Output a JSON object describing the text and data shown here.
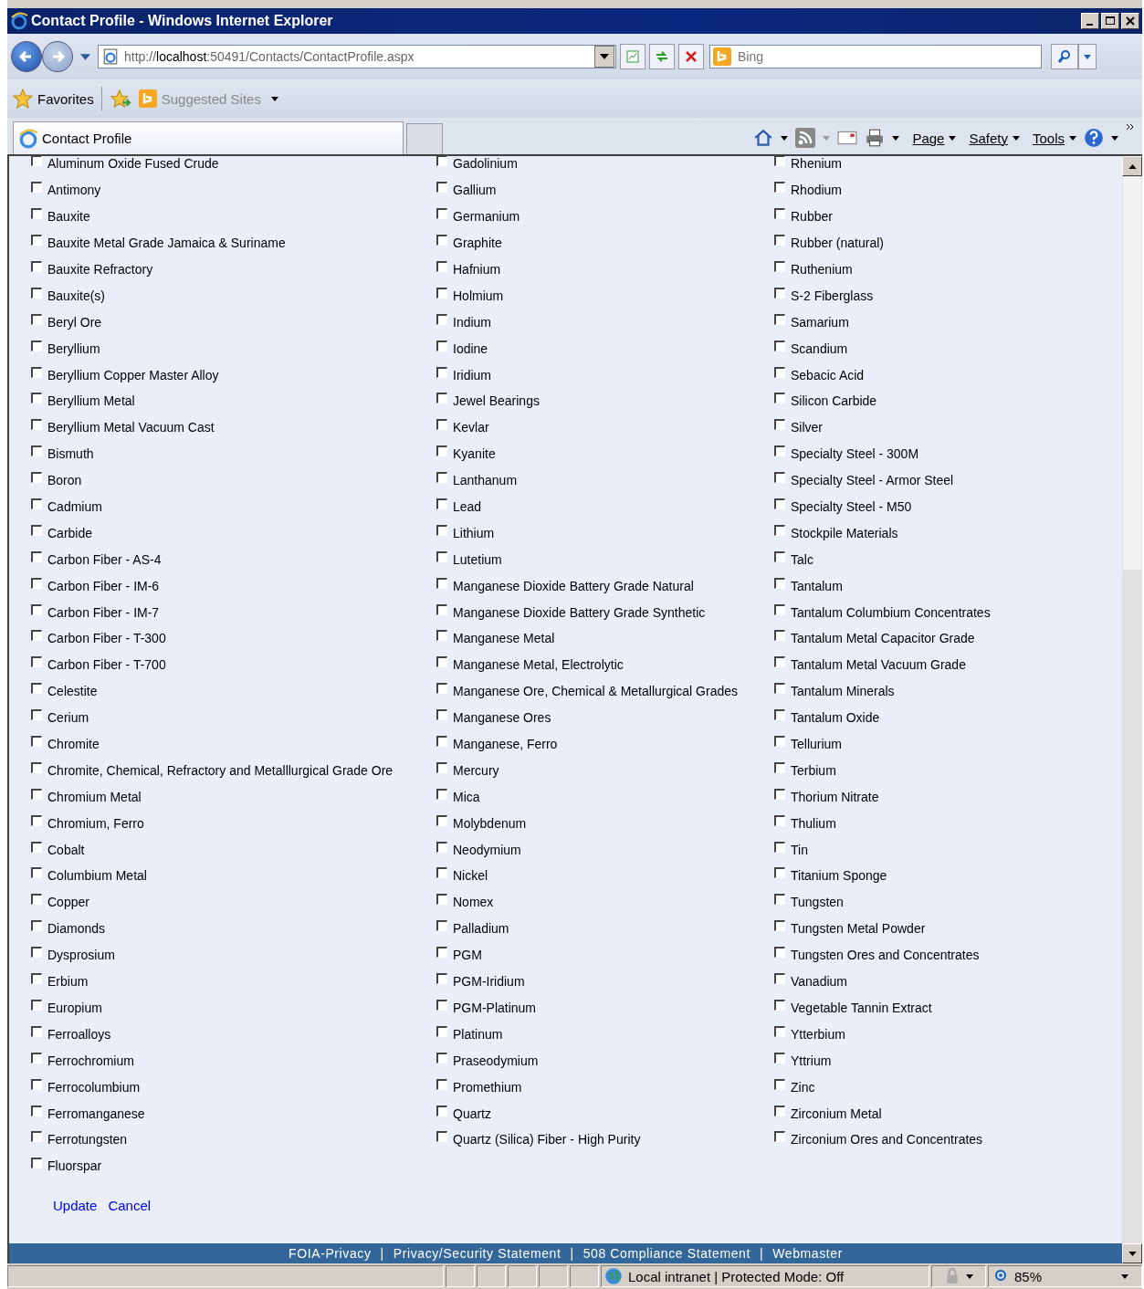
{
  "window": {
    "title": "Contact Profile - Windows Internet Explorer"
  },
  "address_bar": {
    "url_prefix": "http://",
    "url_host": "localhost",
    "url_rest": ":50491/Contacts/ContactProfile.aspx"
  },
  "search": {
    "placeholder": "Bing"
  },
  "favorites_bar": {
    "favorites": "Favorites",
    "suggested_sites": "Suggested Sites"
  },
  "tabs": [
    {
      "label": "Contact Profile",
      "selected": true
    }
  ],
  "command_bar": [
    "Page",
    "Safety",
    "Tools"
  ],
  "columns": [
    {
      "items": [
        {
          "label": "Aluminum Oxide Fused Crude",
          "checked": false
        },
        {
          "label": "Antimony",
          "checked": false
        },
        {
          "label": "Bauxite",
          "checked": false
        },
        {
          "label": "Bauxite Metal Grade Jamaica & Suriname",
          "checked": false
        },
        {
          "label": "Bauxite Refractory",
          "checked": false
        },
        {
          "label": "Bauxite(s)",
          "checked": false
        },
        {
          "label": "Beryl Ore",
          "checked": false
        },
        {
          "label": "Beryllium",
          "checked": false
        },
        {
          "label": "Beryllium Copper Master Alloy",
          "checked": false
        },
        {
          "label": "Beryllium Metal",
          "checked": false
        },
        {
          "label": "Beryllium Metal Vacuum Cast",
          "checked": false
        },
        {
          "label": "Bismuth",
          "checked": false
        },
        {
          "label": "Boron",
          "checked": false
        },
        {
          "label": "Cadmium",
          "checked": false
        },
        {
          "label": "Carbide",
          "checked": false
        },
        {
          "label": "Carbon Fiber - AS-4",
          "checked": false
        },
        {
          "label": "Carbon Fiber - IM-6",
          "checked": false
        },
        {
          "label": "Carbon Fiber - IM-7",
          "checked": false
        },
        {
          "label": "Carbon Fiber - T-300",
          "checked": false
        },
        {
          "label": "Carbon Fiber - T-700",
          "checked": false
        },
        {
          "label": "Celestite",
          "checked": false
        },
        {
          "label": "Cerium",
          "checked": false
        },
        {
          "label": "Chromite",
          "checked": false
        },
        {
          "label": "Chromite, Chemical, Refractory and Metalllurgical Grade Ore",
          "checked": false
        },
        {
          "label": "Chromium Metal",
          "checked": false
        },
        {
          "label": "Chromium, Ferro",
          "checked": false
        },
        {
          "label": "Cobalt",
          "checked": false
        },
        {
          "label": "Columbium Metal",
          "checked": false
        },
        {
          "label": "Copper",
          "checked": false
        },
        {
          "label": "Diamonds",
          "checked": false
        },
        {
          "label": "Dysprosium",
          "checked": false
        },
        {
          "label": "Erbium",
          "checked": false
        },
        {
          "label": "Europium",
          "checked": false
        },
        {
          "label": "Ferroalloys",
          "checked": false
        },
        {
          "label": "Ferrochromium",
          "checked": false
        },
        {
          "label": "Ferrocolumbium",
          "checked": false
        },
        {
          "label": "Ferromanganese",
          "checked": false
        },
        {
          "label": "Ferrotungsten",
          "checked": false
        },
        {
          "label": "Fluorspar",
          "checked": false
        }
      ]
    },
    {
      "items": [
        {
          "label": "Gadolinium",
          "checked": false
        },
        {
          "label": "Gallium",
          "checked": false
        },
        {
          "label": "Germanium",
          "checked": false
        },
        {
          "label": "Graphite",
          "checked": false
        },
        {
          "label": "Hafnium",
          "checked": false
        },
        {
          "label": "Holmium",
          "checked": false
        },
        {
          "label": "Indium",
          "checked": false
        },
        {
          "label": "Iodine",
          "checked": false
        },
        {
          "label": "Iridium",
          "checked": false
        },
        {
          "label": "Jewel Bearings",
          "checked": false
        },
        {
          "label": "Kevlar",
          "checked": false
        },
        {
          "label": "Kyanite",
          "checked": false
        },
        {
          "label": "Lanthanum",
          "checked": false
        },
        {
          "label": "Lead",
          "checked": false
        },
        {
          "label": "Lithium",
          "checked": false
        },
        {
          "label": "Lutetium",
          "checked": false
        },
        {
          "label": "Manganese Dioxide Battery Grade Natural",
          "checked": false
        },
        {
          "label": "Manganese Dioxide Battery Grade Synthetic",
          "checked": false
        },
        {
          "label": "Manganese Metal",
          "checked": false
        },
        {
          "label": "Manganese Metal, Electrolytic",
          "checked": false
        },
        {
          "label": "Manganese Ore, Chemical & Metallurgical Grades",
          "checked": false
        },
        {
          "label": "Manganese Ores",
          "checked": false
        },
        {
          "label": "Manganese, Ferro",
          "checked": false
        },
        {
          "label": "Mercury",
          "checked": false
        },
        {
          "label": "Mica",
          "checked": false
        },
        {
          "label": "Molybdenum",
          "checked": false
        },
        {
          "label": "Neodymium",
          "checked": false
        },
        {
          "label": "Nickel",
          "checked": false
        },
        {
          "label": "Nomex",
          "checked": false
        },
        {
          "label": "Palladium",
          "checked": false
        },
        {
          "label": "PGM",
          "checked": false
        },
        {
          "label": "PGM-Iridium",
          "checked": false
        },
        {
          "label": "PGM-Platinum",
          "checked": false
        },
        {
          "label": "Platinum",
          "checked": false
        },
        {
          "label": "Praseodymium",
          "checked": false
        },
        {
          "label": "Promethium",
          "checked": false
        },
        {
          "label": "Quartz",
          "checked": false
        },
        {
          "label": "Quartz (Silica) Fiber - High Purity",
          "checked": false
        }
      ]
    },
    {
      "items": [
        {
          "label": "Rhenium",
          "checked": false
        },
        {
          "label": "Rhodium",
          "checked": false
        },
        {
          "label": "Rubber",
          "checked": false
        },
        {
          "label": "Rubber (natural)",
          "checked": false
        },
        {
          "label": "Ruthenium",
          "checked": false
        },
        {
          "label": "S-2 Fiberglass",
          "checked": false
        },
        {
          "label": "Samarium",
          "checked": false
        },
        {
          "label": "Scandium",
          "checked": false
        },
        {
          "label": "Sebacic Acid",
          "checked": false
        },
        {
          "label": "Silicon Carbide",
          "checked": false
        },
        {
          "label": "Silver",
          "checked": false
        },
        {
          "label": "Specialty Steel - 300M",
          "checked": false
        },
        {
          "label": "Specialty Steel - Armor Steel",
          "checked": false
        },
        {
          "label": "Specialty Steel - M50",
          "checked": false
        },
        {
          "label": "Stockpile Materials",
          "checked": false
        },
        {
          "label": "Talc",
          "checked": false
        },
        {
          "label": "Tantalum",
          "checked": false
        },
        {
          "label": "Tantalum Columbium Concentrates",
          "checked": false
        },
        {
          "label": "Tantalum Metal Capacitor Grade",
          "checked": false
        },
        {
          "label": "Tantalum Metal Vacuum Grade",
          "checked": false
        },
        {
          "label": "Tantalum Minerals",
          "checked": false
        },
        {
          "label": "Tantalum Oxide",
          "checked": false
        },
        {
          "label": "Tellurium",
          "checked": false
        },
        {
          "label": "Terbium",
          "checked": false
        },
        {
          "label": "Thorium Nitrate",
          "checked": false
        },
        {
          "label": "Thulium",
          "checked": false
        },
        {
          "label": "Tin",
          "checked": false
        },
        {
          "label": "Titanium Sponge",
          "checked": false
        },
        {
          "label": "Tungsten",
          "checked": false
        },
        {
          "label": "Tungsten Metal Powder",
          "checked": false
        },
        {
          "label": "Tungsten Ores and Concentrates",
          "checked": false
        },
        {
          "label": "Vanadium",
          "checked": false
        },
        {
          "label": "Vegetable Tannin Extract",
          "checked": false
        },
        {
          "label": "Ytterbium",
          "checked": false
        },
        {
          "label": "Yttrium",
          "checked": false
        },
        {
          "label": "Zinc",
          "checked": false
        },
        {
          "label": "Zirconium Metal",
          "checked": false
        },
        {
          "label": "Zirconium Ores and Concentrates",
          "checked": false
        }
      ]
    }
  ],
  "actions": [
    "Update",
    "Cancel"
  ],
  "footer_links": [
    "FOIA-Privacy",
    "Privacy/Security Statement",
    "508 Compliance Statement",
    "Webmaster"
  ],
  "footer_separators": [
    "|",
    "|",
    "|"
  ],
  "status_bar": {
    "zone": "Local intranet | Protected Mode: Off",
    "zoom": "85%"
  }
}
